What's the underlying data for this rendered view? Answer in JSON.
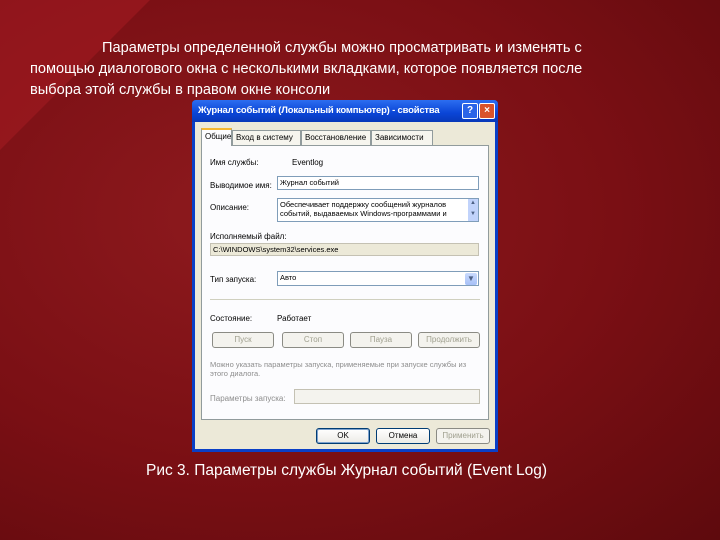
{
  "slide": {
    "intro_line1": "Параметры определенной службы можно просматривать и изменять с",
    "intro_line2": "помощью диалогового окна с несколькими вкладками, которое появляется после",
    "intro_line3": "выбора этой службы в правом окне консоли",
    "caption": "Рис 3. Параметры службы Журнал событий (Event Log)"
  },
  "dialog": {
    "title": "Журнал событий (Локальный компьютер) - свойства",
    "help_glyph": "?",
    "close_glyph": "×",
    "tabs": [
      "Общие",
      "Вход в систему",
      "Восстановление",
      "Зависимости"
    ],
    "fields": {
      "service_name_label": "Имя службы:",
      "service_name_value": "Eventlog",
      "display_name_label": "Выводимое имя:",
      "display_name_value": "Журнал событий",
      "description_label": "Описание:",
      "description_value": "Обеспечивает поддержку сообщений журналов событий, выдаваемых Windows-программами и",
      "exe_path_label": "Исполняемый файл:",
      "exe_path_value": "C:\\WINDOWS\\system32\\services.exe",
      "startup_type_label": "Тип запуска:",
      "startup_type_value": "Авто",
      "status_label": "Состояние:",
      "status_value": "Работает"
    },
    "buttons": {
      "start": "Пуск",
      "stop": "Стоп",
      "pause": "Пауза",
      "resume": "Продолжить",
      "ok": "OK",
      "cancel": "Отмена",
      "apply": "Применить"
    },
    "note": "Можно указать параметры запуска, применяемые при запуске службы из этого диалога.",
    "start_params_label": "Параметры запуска:"
  }
}
